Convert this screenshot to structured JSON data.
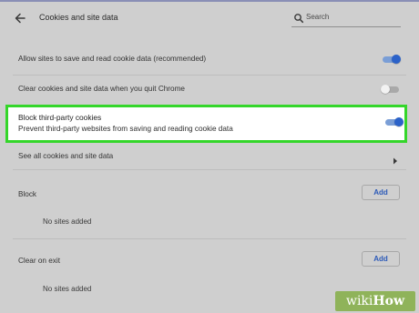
{
  "header": {
    "title": "Cookies and site data",
    "search_placeholder": "Search"
  },
  "settings": {
    "allow_label": "Allow sites to save and read cookie data (recommended)",
    "allow_enabled": true,
    "clear_on_quit_label": "Clear cookies and site data when you quit Chrome",
    "clear_on_quit_enabled": false,
    "block_third_party_title": "Block third-party cookies",
    "block_third_party_desc": "Prevent third-party websites from saving and reading cookie data",
    "block_third_party_enabled": true,
    "see_all_label": "See all cookies and site data"
  },
  "block_section": {
    "label": "Block",
    "add_label": "Add",
    "empty_text": "No sites added"
  },
  "clear_on_exit_section": {
    "label": "Clear on exit",
    "add_label": "Add",
    "empty_text": "No sites added"
  },
  "colors": {
    "highlight_border": "#34d62a",
    "toggle_on": "#2b62c9",
    "link_blue": "#2c5ab8"
  },
  "watermark": {
    "text_wiki": "wiki",
    "text_how": "How"
  }
}
